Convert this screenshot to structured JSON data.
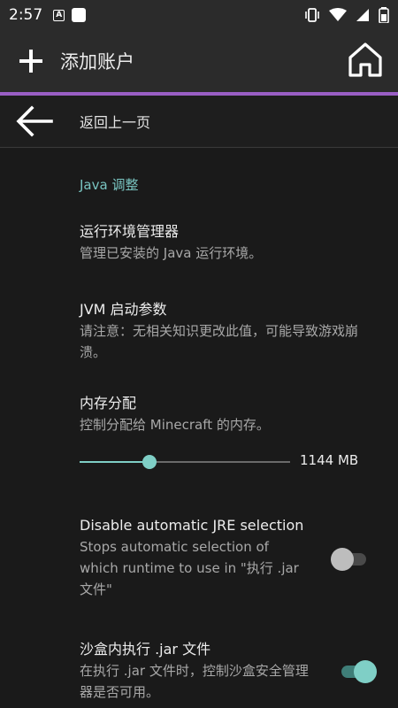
{
  "status_bar": {
    "time": "2:57",
    "icons": [
      "notification-a-icon",
      "app-square-icon",
      "vibrate-icon",
      "wifi-icon",
      "signal-icon",
      "battery-icon"
    ]
  },
  "app_bar": {
    "title": "添加账户",
    "accent_color": "#9a5fc5"
  },
  "back_row": {
    "label": "返回上一页"
  },
  "section": {
    "title": "Java 调整",
    "title_color": "#79c4c0"
  },
  "prefs": {
    "runtime_manager": {
      "title": "运行环境管理器",
      "summary": "管理已安装的 Java 运行环境。"
    },
    "jvm_args": {
      "title": "JVM 启动参数",
      "summary": "请注意：无相关知识更改此值，可能导致游戏崩溃。"
    },
    "memory": {
      "title": "内存分配",
      "summary": "控制分配给 Minecraft 的内存。",
      "value_label": "1144 MB",
      "slider_fraction": 0.33
    },
    "auto_jre": {
      "title": "Disable automatic JRE selection",
      "summary": "Stops automatic selection of which runtime to use in \"执行 .jar 文件\"",
      "enabled": false
    },
    "sandbox": {
      "title": "沙盒内执行 .jar 文件",
      "summary": "在执行 .jar 文件时，控制沙盒安全管理器是否可用。",
      "enabled": true
    }
  }
}
